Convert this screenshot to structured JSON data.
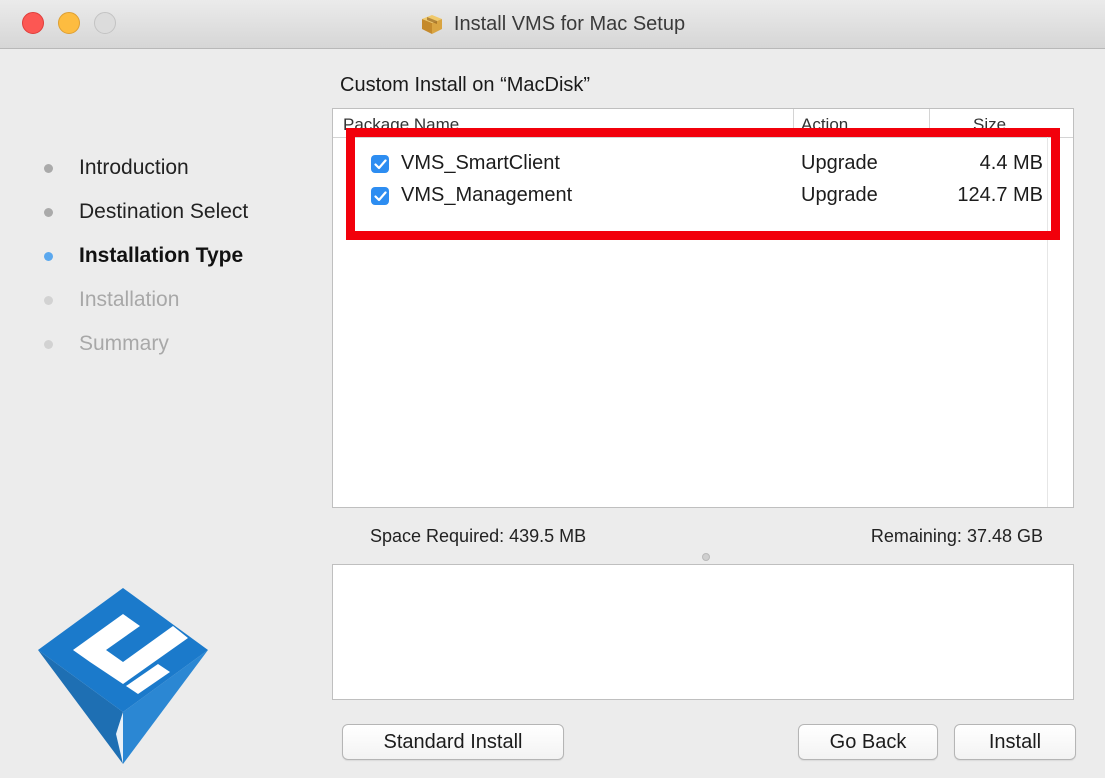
{
  "window": {
    "title": "Install VMS for Mac Setup",
    "icon": "package-icon"
  },
  "sidebar": {
    "steps": [
      {
        "label": "Introduction",
        "state": "done"
      },
      {
        "label": "Destination Select",
        "state": "done"
      },
      {
        "label": "Installation Type",
        "state": "current"
      },
      {
        "label": "Installation",
        "state": "future"
      },
      {
        "label": "Summary",
        "state": "future"
      }
    ]
  },
  "main": {
    "heading": "Custom Install on “MacDisk”",
    "table": {
      "columns": [
        "Package Name",
        "Action",
        "Size"
      ],
      "rows": [
        {
          "checked": true,
          "name": "VMS_SmartClient",
          "action": "Upgrade",
          "size": "4.4 MB"
        },
        {
          "checked": true,
          "name": "VMS_Management",
          "action": "Upgrade",
          "size": "124.7 MB"
        }
      ]
    },
    "space_required": "Space Required:  439.5 MB",
    "remaining": "Remaining:  37.48 GB"
  },
  "buttons": {
    "standard_install": "Standard Install",
    "go_back": "Go Back",
    "install": "Install"
  },
  "colors": {
    "highlight": "#f2000b",
    "accent": "#2d8df1",
    "current_step_dot": "#5ba8ee"
  }
}
